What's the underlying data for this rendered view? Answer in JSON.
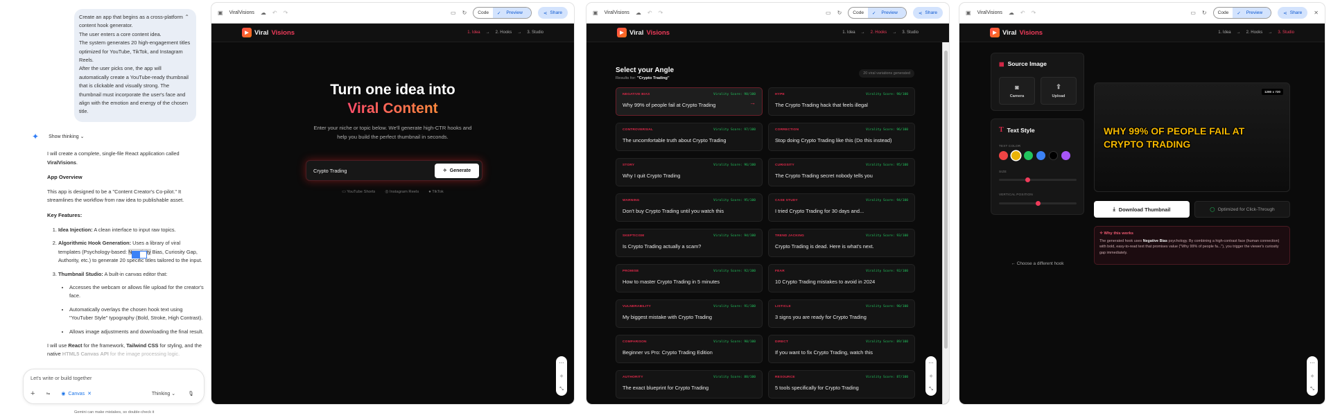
{
  "chat": {
    "prompt": [
      "Create an app that begins as a cross-platform content hook generator.",
      "The user enters a core content idea.",
      "The system generates 20 high-engagement titles optimized for YouTube, TikTok, and Instagram Reels.",
      "After the user picks one, the app will automatically create a YouTube-ready thumbnail that is clickable and visually strong. The thumbnail must incorporate the user's face and align with the emotion and energy of the chosen title."
    ],
    "show_thinking": "Show thinking",
    "intro_a": "I will create a complete, single-file React application called ",
    "intro_b": "ViralVisions",
    "intro_c": ".",
    "overview_h": "App Overview",
    "overview": "This app is designed to be a \"Content Creator's Co-pilot.\" It streamlines the workflow from raw idea to publishable asset.",
    "features_h": "Key Features:",
    "f1_b": "Idea Injection:",
    "f1": " A clean interface to input raw topics.",
    "f2_b": "Algorithmic Hook Generation:",
    "f2_a": " Uses a library of viral templates (Psychology-based: ",
    "f2_hl": "Negativity",
    "f2_c": " Bias, Curiosity Gap, Authority, etc.) to generate 20 specific titles tailored to the input.",
    "f3_b": "Thumbnail Studio:",
    "f3": " A built-in canvas editor that:",
    "f3_items": [
      "Accesses the webcam or allows file upload for the creator's face.",
      "Automatically overlays the chosen hook text using \"YouTuber Style\" typography (Bold, Stroke, High Contrast).",
      "Allows image adjustments and downloading the final result."
    ],
    "tail_a": "I will use ",
    "tail_b": "React",
    "tail_c": " for the framework, ",
    "tail_d": "Tailwind CSS",
    "tail_e": " for styling, and the native ",
    "tail_f": "HTML5 Canvas API",
    "tail_g": " for the image processing logic.",
    "input_placeholder": "Let's write or build together",
    "canvas_chip": "Canvas",
    "mode": "Thinking",
    "disclaimer": "Gemini can make mistakes, so double-check it"
  },
  "toolbar": {
    "title": "ViralVisions",
    "code": "Code",
    "preview": "Preview",
    "share": "Share"
  },
  "app": {
    "logo_a": "Viral",
    "logo_b": "Visions",
    "steps": [
      "1. Idea",
      "2. Hooks",
      "3. Studio"
    ],
    "arrow": "→"
  },
  "idea": {
    "title_1": "Turn one idea into",
    "title_2": "Viral Content",
    "sub_1": "Enter your niche or topic below. We'll generate high-CTR hooks and",
    "sub_2": "help you build the perfect thumbnail in seconds.",
    "input_value": "Crypto Trading",
    "generate": "Generate",
    "platforms": [
      "YouTube Shorts",
      "Instagram Reels",
      "TikTok"
    ]
  },
  "hooks": {
    "title": "Select your Angle",
    "results_label": "Results for: ",
    "results_value": "\"Crypto Trading\"",
    "badge": "20 viral variations generated",
    "score_prefix": "Virality Score: ",
    "items": [
      {
        "cat": "NEGATIVE BIAS",
        "score": "98/100",
        "title": "Why 99% of people fail at Crypto Trading",
        "selected": true
      },
      {
        "cat": "HYPE",
        "score": "98/100",
        "title": "The Crypto Trading hack that feels illegal"
      },
      {
        "cat": "CONTROVERSIAL",
        "score": "97/100",
        "title": "The uncomfortable truth about Crypto Trading"
      },
      {
        "cat": "CORRECTION",
        "score": "96/100",
        "title": "Stop doing Crypto Trading like this (Do this instead)"
      },
      {
        "cat": "STORY",
        "score": "96/100",
        "title": "Why I quit Crypto Trading"
      },
      {
        "cat": "CURIOSITY",
        "score": "95/100",
        "title": "The Crypto Trading secret nobody tells you"
      },
      {
        "cat": "WARNING",
        "score": "95/100",
        "title": "Don't buy Crypto Trading until you watch this"
      },
      {
        "cat": "CASE STUDY",
        "score": "94/100",
        "title": "I tried Crypto Trading for 30 days and..."
      },
      {
        "cat": "SKEPTICISM",
        "score": "94/100",
        "title": "Is Crypto Trading actually a scam?"
      },
      {
        "cat": "TREND JACKING",
        "score": "93/100",
        "title": "Crypto Trading is dead. Here is what's next."
      },
      {
        "cat": "PROMISE",
        "score": "92/100",
        "title": "How to master Crypto Trading in 5 minutes"
      },
      {
        "cat": "FEAR",
        "score": "92/100",
        "title": "10 Crypto Trading mistakes to avoid in 2024"
      },
      {
        "cat": "VULNERABILITY",
        "score": "91/100",
        "title": "My biggest mistake with Crypto Trading"
      },
      {
        "cat": "LISTICLE",
        "score": "90/100",
        "title": "3 signs you are ready for Crypto Trading"
      },
      {
        "cat": "COMPARISON",
        "score": "90/100",
        "title": "Beginner vs Pro: Crypto Trading Edition"
      },
      {
        "cat": "DIRECT",
        "score": "89/100",
        "title": "If you want to fix Crypto Trading, watch this"
      },
      {
        "cat": "AUTHORITY",
        "score": "88/100",
        "title": "The exact blueprint for Crypto Trading"
      },
      {
        "cat": "RESOURCE",
        "score": "87/100",
        "title": "5 tools specifically for Crypto Trading"
      }
    ]
  },
  "studio": {
    "source_title": "Source Image",
    "camera": "Camera",
    "upload": "Upload",
    "text_style_title": "Text Style",
    "text_color_label": "TEXT COLOR",
    "colors": [
      "#ef4444",
      "#eab308",
      "#22c55e",
      "#3b82f6",
      "#000000",
      "#a855f7"
    ],
    "selected_color": "#eab308",
    "size_label": "SIZE",
    "size_value": 0.37,
    "vpos_label": "VERTICAL POSITION",
    "vpos_value": 0.5,
    "back": "← Choose a different hook",
    "dims": "1280 x 720",
    "thumb_text_1": "WHY 99% OF PEOPLE FAIL AT",
    "thumb_text_2": "CRYPTO TRADING",
    "download": "Download Thumbnail",
    "optimized": "Optimized for Click-Through",
    "why_title": "Why this works",
    "why_a": "The generated hook uses ",
    "why_b": "Negative Bias",
    "why_c": " psychology. By combining a high-contrast face (human connection) with bold, easy-to-read text that promises value (\"Why 99% of people fa...\"), you trigger the viewer's curiosity gap immediately."
  },
  "colors": {
    "accent": "#ef3b5a",
    "score": "#22c55e",
    "thumb_text": "#f5b800",
    "app_bg": "#0b0b0b"
  }
}
